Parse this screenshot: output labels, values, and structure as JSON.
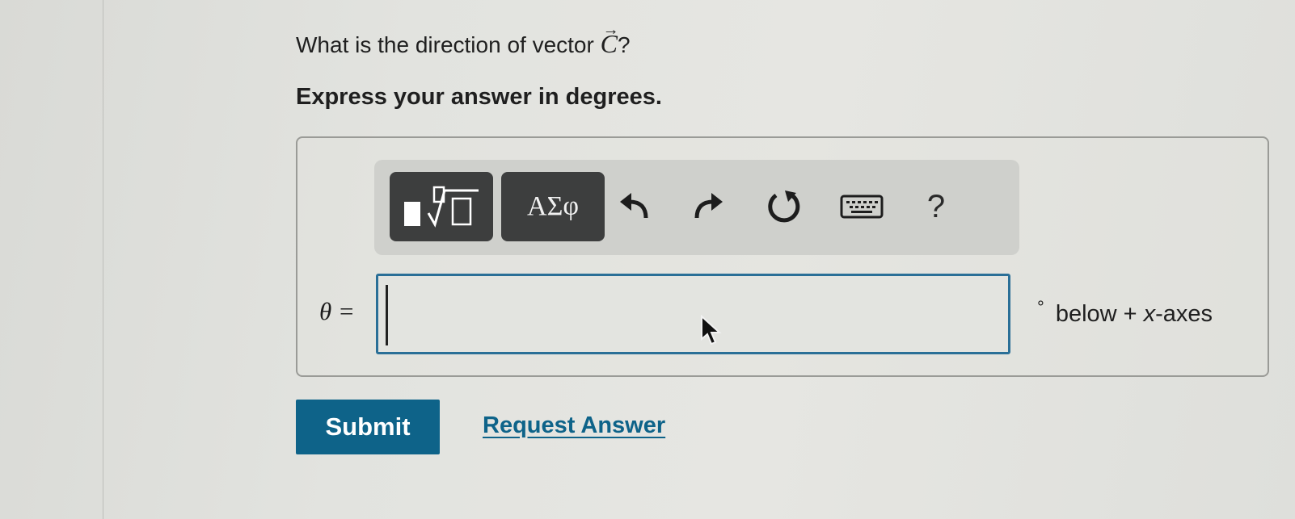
{
  "question": {
    "prefix": "What is the direction of vector ",
    "vector_symbol": "C",
    "vector_arrow": "⃗",
    "suffix": "?"
  },
  "instruction": "Express your answer in degrees.",
  "toolbar": {
    "templates_icon": "templates-root-icon",
    "symbols_label": "ΑΣφ",
    "undo_icon": "undo-icon",
    "redo_icon": "redo-icon",
    "reset_icon": "reset-icon",
    "keyboard_icon": "keyboard-icon",
    "help_label": "?"
  },
  "answer": {
    "variable": "θ",
    "equals": " =",
    "value": "",
    "unit_degree": "°",
    "unit_prefix": "below + ",
    "unit_var": "x",
    "unit_suffix": "-axes"
  },
  "actions": {
    "submit_label": "Submit",
    "request_label": "Request Answer"
  },
  "colors": {
    "accent": "#0e6389",
    "input_border": "#2a6f97",
    "toolbar_dark_button": "#3d3e3e"
  }
}
